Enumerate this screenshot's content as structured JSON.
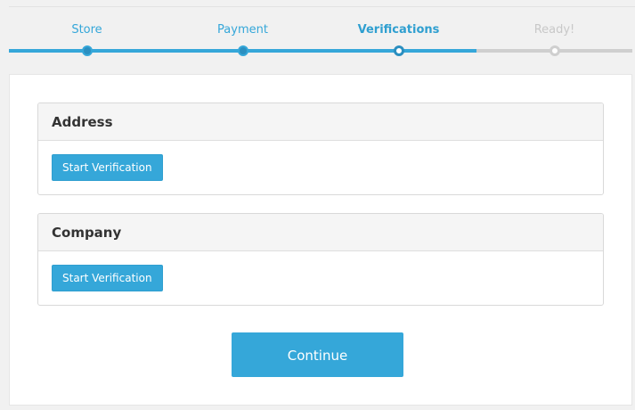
{
  "stepper": {
    "steps": [
      {
        "label": "Store",
        "state": "done"
      },
      {
        "label": "Payment",
        "state": "done"
      },
      {
        "label": "Verifications",
        "state": "current"
      },
      {
        "label": "Ready!",
        "state": "future"
      }
    ]
  },
  "panels": [
    {
      "title": "Address",
      "button_label": "Start Verification"
    },
    {
      "title": "Company",
      "button_label": "Start Verification"
    }
  ],
  "actions": {
    "continue_label": "Continue"
  },
  "colors": {
    "accent": "#35a7d9",
    "inactive": "#cfcfcf",
    "background": "#f1f1f1"
  }
}
